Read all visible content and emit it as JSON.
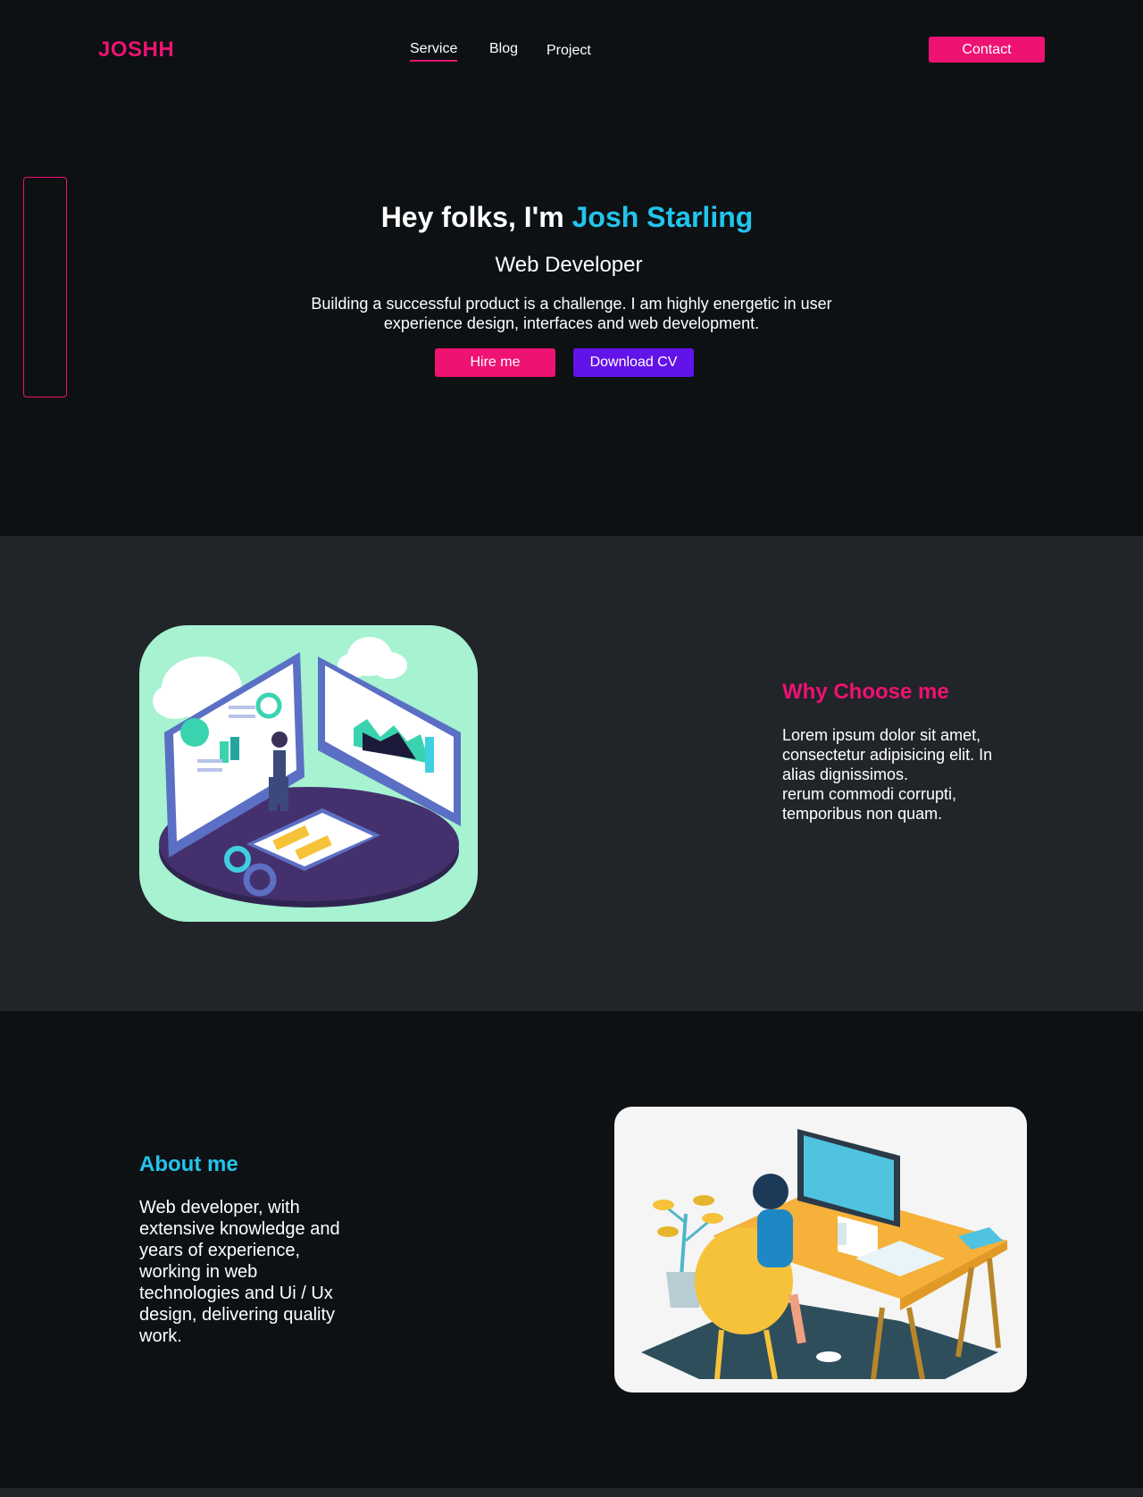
{
  "header": {
    "logo": "JOSHH",
    "nav": [
      "Service",
      "Blog",
      "Project"
    ],
    "contact_label": "Contact"
  },
  "hero": {
    "greeting": "Hey folks, I'm ",
    "name": "Josh Starling",
    "role": "Web Developer",
    "description": "Building a successful product is a challenge. I am highly energetic in user experience design, interfaces and web development.",
    "hire_label": "Hire me",
    "cv_label": "Download CV"
  },
  "why": {
    "title": "Why Choose me",
    "text_line1": "Lorem ipsum dolor sit amet, consectetur adipisicing elit. In alias dignissimos.",
    "text_line2": "rerum commodi corrupti, temporibus non quam."
  },
  "about": {
    "title": "About me",
    "text": "Web developer, with extensive knowledge and years of experience, working in web technologies and Ui / Ux design, delivering quality work."
  },
  "colors": {
    "accent_pink": "#ee1272",
    "accent_cyan": "#23c4ec",
    "accent_purple": "#6213e8",
    "bg_dark": "#0d1114",
    "bg_section": "#212429"
  },
  "icons": {
    "why_illustration": "analytics-dashboard-illustration",
    "about_illustration": "developer-at-desk-illustration"
  }
}
